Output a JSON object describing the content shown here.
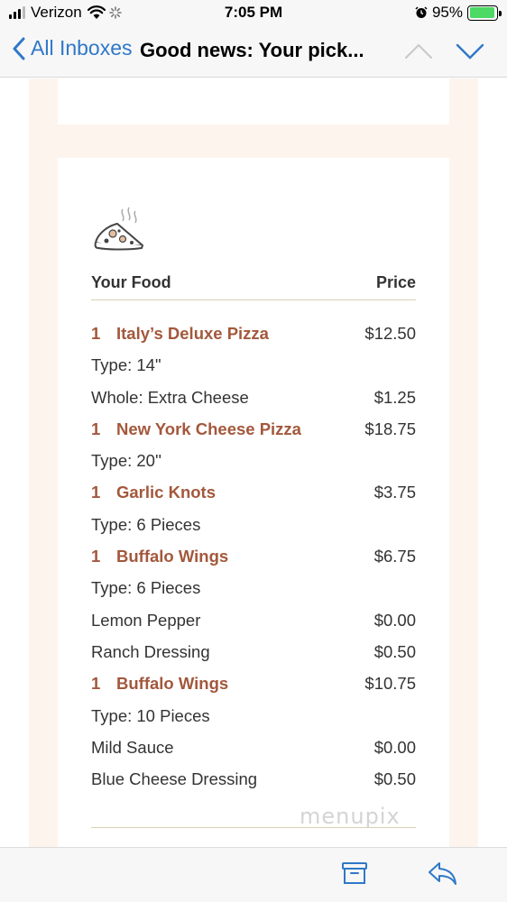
{
  "status_bar": {
    "carrier": "Verizon",
    "time": "7:05 PM",
    "battery_percent": "95%",
    "battery_level": 0.95
  },
  "nav": {
    "back_label": "All Inboxes",
    "subject": "Good news: Your pick..."
  },
  "order": {
    "header_food": "Your Food",
    "header_price": "Price",
    "rows": [
      {
        "kind": "item",
        "qty": "1",
        "desc": "Italy’s Deluxe Pizza",
        "price": "$12.50"
      },
      {
        "kind": "detail",
        "desc": "Type: 14\"",
        "price": ""
      },
      {
        "kind": "detail",
        "desc": "Whole: Extra Cheese",
        "price": "$1.25"
      },
      {
        "kind": "item",
        "qty": "1",
        "desc": "New York Cheese Pizza",
        "price": "$18.75"
      },
      {
        "kind": "detail",
        "desc": "Type: 20''",
        "price": ""
      },
      {
        "kind": "item",
        "qty": "1",
        "desc": "Garlic Knots",
        "price": "$3.75"
      },
      {
        "kind": "detail",
        "desc": "Type: 6 Pieces",
        "price": ""
      },
      {
        "kind": "item",
        "qty": "1",
        "desc": "Buffalo Wings",
        "price": "$6.75"
      },
      {
        "kind": "detail",
        "desc": "Type: 6 Pieces",
        "price": ""
      },
      {
        "kind": "detail",
        "desc": "Lemon Pepper",
        "price": "$0.00"
      },
      {
        "kind": "detail",
        "desc": "Ranch Dressing",
        "price": "$0.50"
      },
      {
        "kind": "item",
        "qty": "1",
        "desc": "Buffalo Wings",
        "price": "$10.75"
      },
      {
        "kind": "detail",
        "desc": "Type: 10 Pieces",
        "price": ""
      },
      {
        "kind": "detail",
        "desc": "Mild Sauce",
        "price": "$0.00"
      },
      {
        "kind": "detail",
        "desc": "Blue Cheese Dressing",
        "price": "$0.50"
      }
    ]
  },
  "watermark": "menupix",
  "icons": {
    "back": "chevron-left-icon",
    "prev": "chevron-up-icon",
    "next": "chevron-down-icon",
    "archive": "archive-icon",
    "reply": "reply-icon",
    "food": "pizza-slice-icon"
  },
  "colors": {
    "accent": "#2f78c8",
    "item_name": "#a3583c",
    "frame": "#fdf4ee",
    "rule": "#d9cfb4"
  }
}
